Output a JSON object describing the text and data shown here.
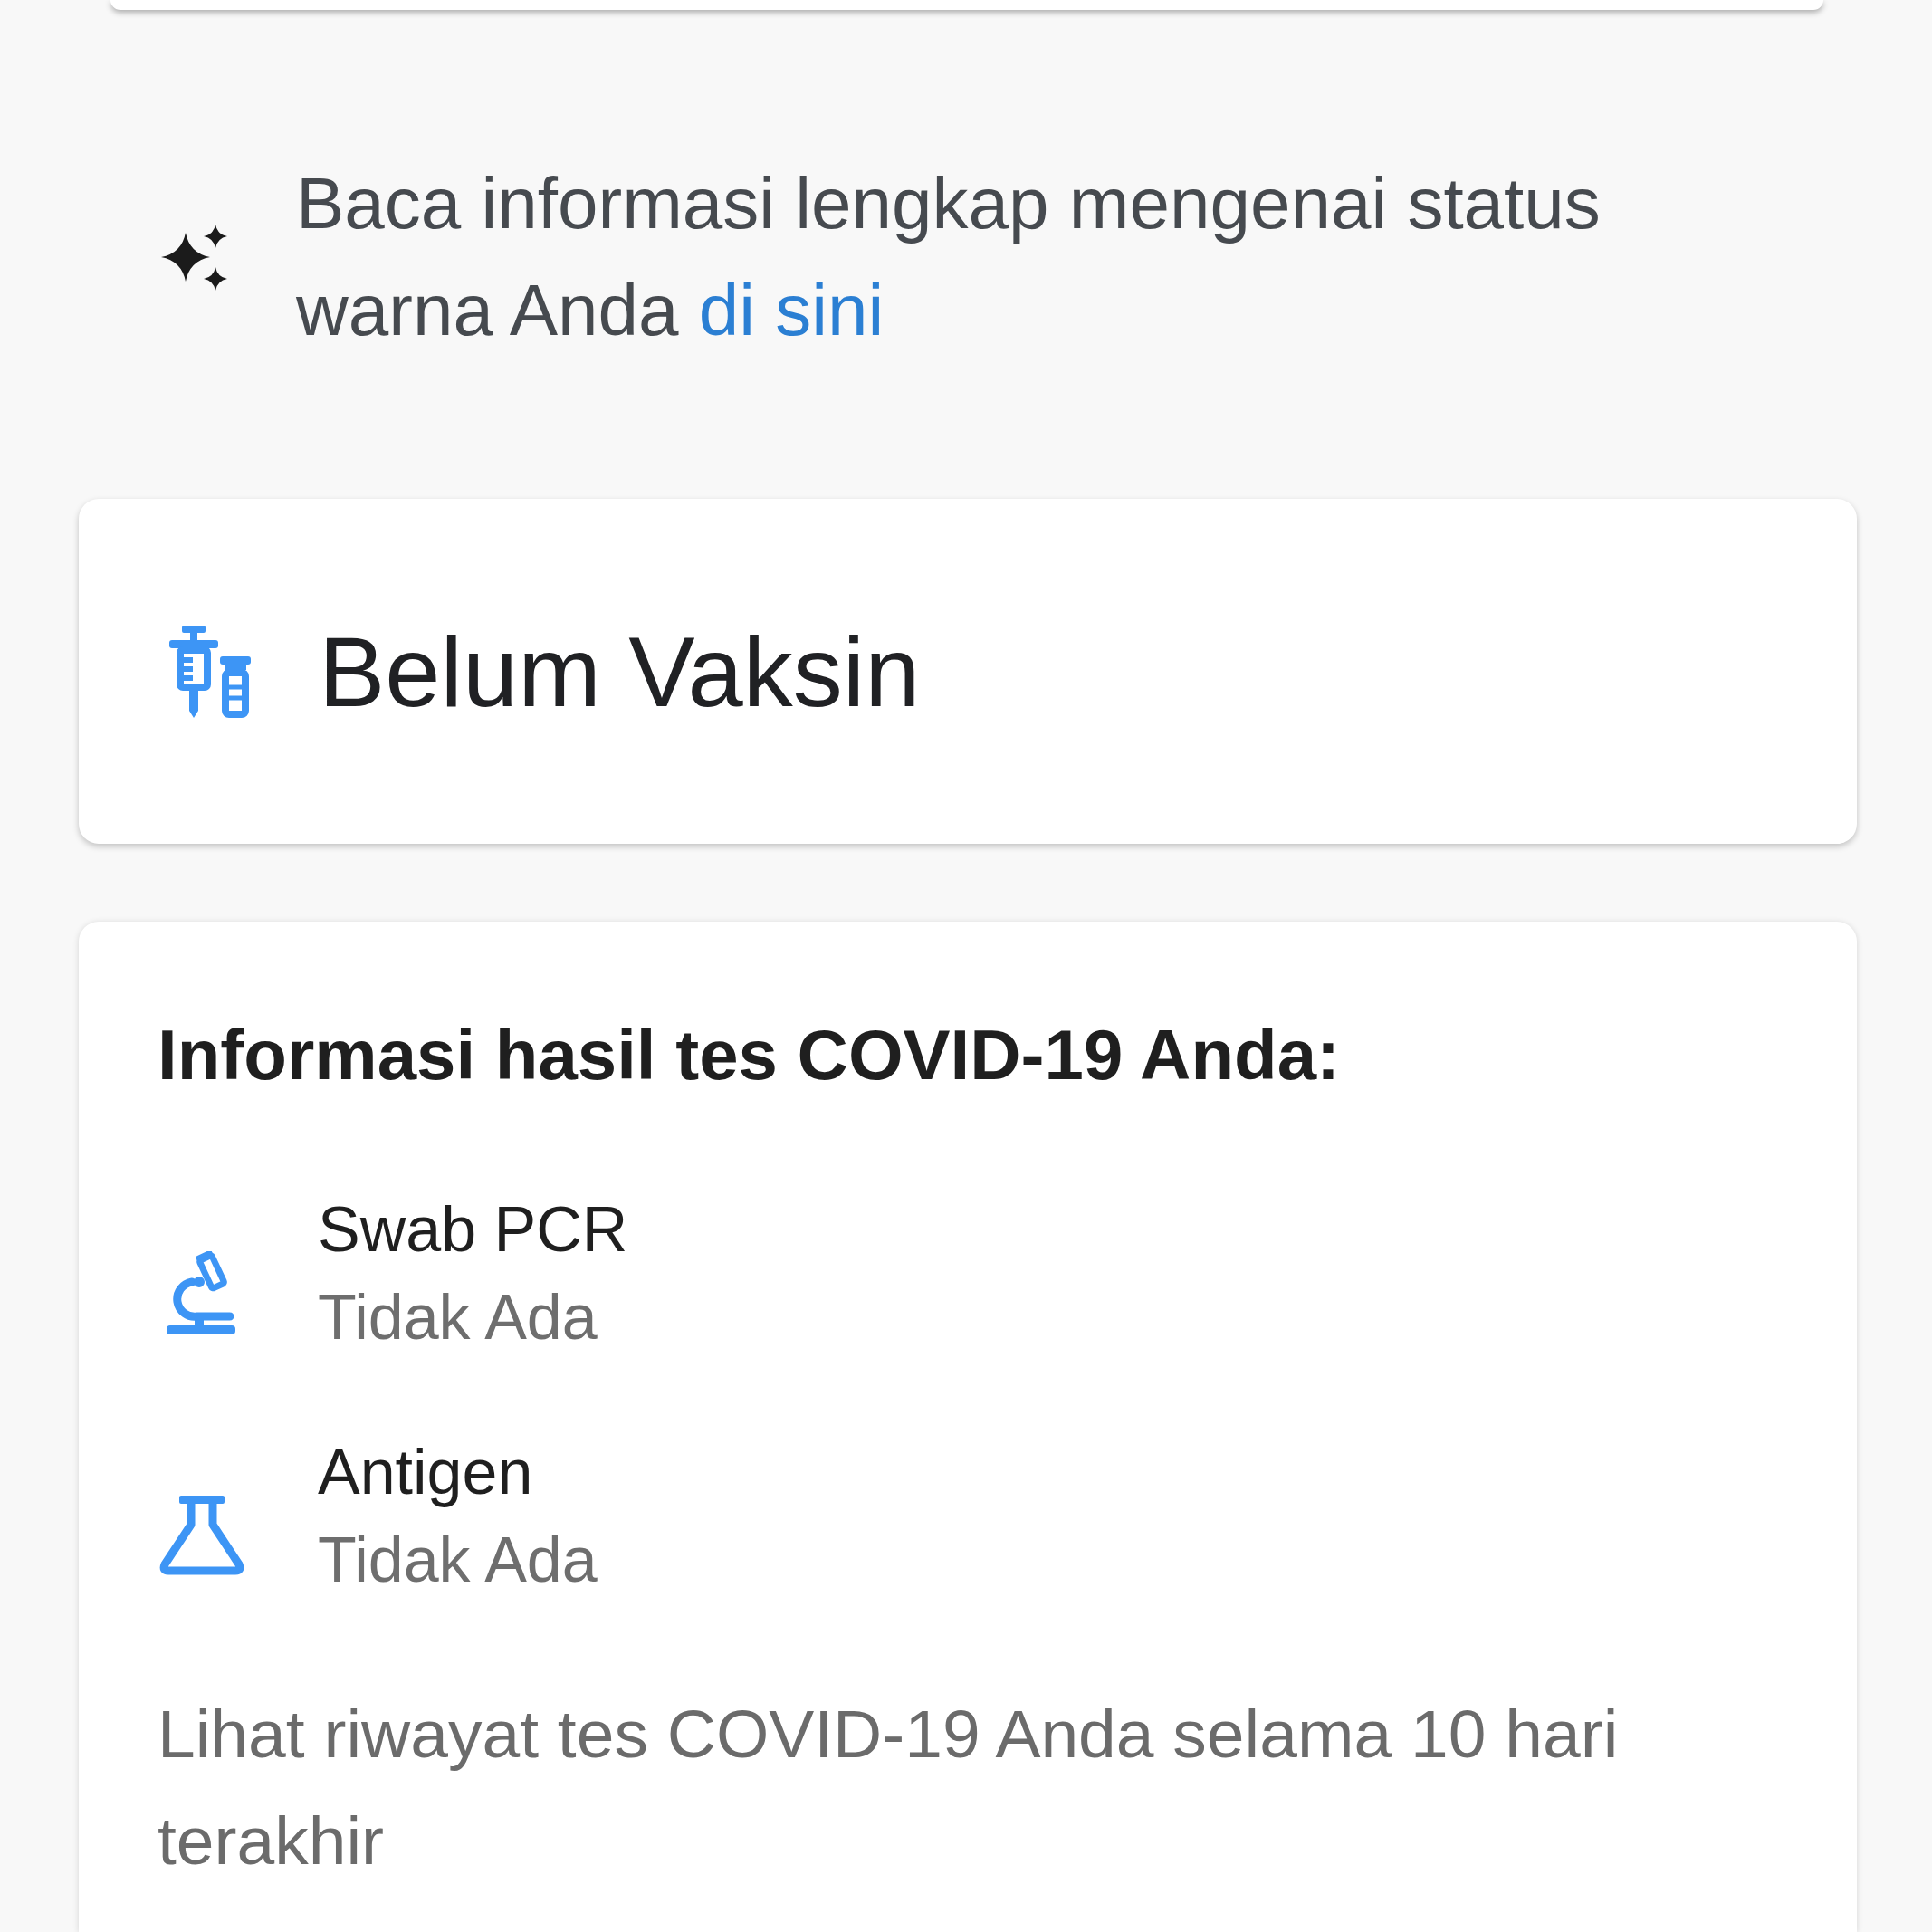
{
  "info_banner": {
    "text": "Baca informasi lengkap mengenai status warna Anda",
    "link": "di sini"
  },
  "vaccine_card": {
    "status": "Belum Vaksin"
  },
  "test_results": {
    "title": "Informasi hasil tes COVID-19 Anda:",
    "items": [
      {
        "kind": "pcr",
        "name": "Swab PCR",
        "result": "Tidak Ada"
      },
      {
        "kind": "antigen",
        "name": "Antigen",
        "result": "Tidak Ada"
      }
    ],
    "history_text": "Lihat riwayat tes COVID-19 Anda selama 10 hari terakhir"
  }
}
